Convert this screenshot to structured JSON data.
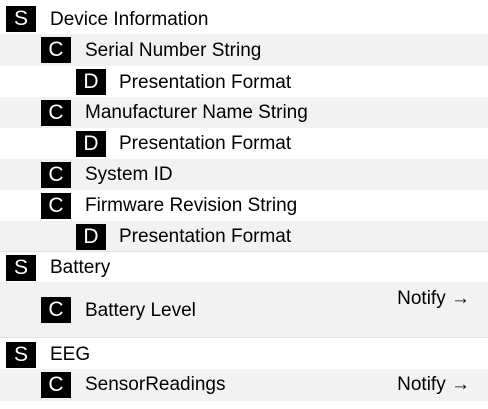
{
  "tree": {
    "rows": [
      {
        "type": "S",
        "label": "Device Information",
        "action": ""
      },
      {
        "type": "C",
        "label": "Serial Number String",
        "action": ""
      },
      {
        "type": "D",
        "label": "Presentation Format",
        "action": ""
      },
      {
        "type": "C",
        "label": "Manufacturer Name String",
        "action": ""
      },
      {
        "type": "D",
        "label": "Presentation Format",
        "action": ""
      },
      {
        "type": "C",
        "label": "System ID",
        "action": ""
      },
      {
        "type": "C",
        "label": "Firmware Revision String",
        "action": ""
      },
      {
        "type": "D",
        "label": "Presentation Format",
        "action": ""
      },
      {
        "type": "S",
        "label": "Battery",
        "action": ""
      },
      {
        "type": "C",
        "label": "Battery Level",
        "action": "Notify →"
      },
      {
        "type": "S",
        "label": "EEG",
        "action": ""
      },
      {
        "type": "C",
        "label": "SensorReadings",
        "action": "Notify →"
      }
    ]
  }
}
